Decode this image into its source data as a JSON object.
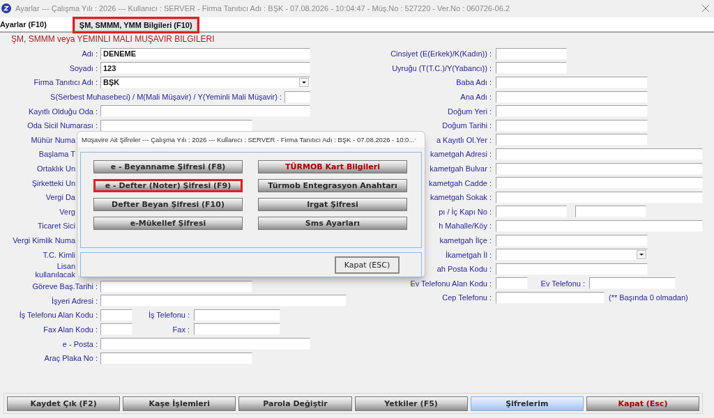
{
  "window": {
    "title": "Ayarlar --- Çalışma Yılı : 2026 --- Kullanıcı : SERVER - Firma Tanıtıcı Adı : BŞK - 07.08.2026 - 10:04:47 - Müş.No : 527220 - Ver.No : 060726-06.2"
  },
  "tabs": [
    {
      "label": "Ayarlar (F10)",
      "selected": false,
      "highlighted": false
    },
    {
      "label": "ŞM, SMMM, YMM Bilgileri (F10)",
      "selected": true,
      "highlighted": true
    }
  ],
  "heading": "ŞM, SMMM veya YEMINLI MALI MUŞAVIR BILGILERI",
  "left_rows": [
    {
      "label": "Adı :",
      "fields": [
        {
          "kind": "long",
          "value": "DENEME"
        }
      ]
    },
    {
      "label": "Soyadı :",
      "fields": [
        {
          "kind": "long",
          "value": "123"
        }
      ]
    },
    {
      "label": "Firma Tanıtıcı Adı :",
      "fields": [
        {
          "kind": "long",
          "value": "BŞK",
          "dropdown": true
        }
      ]
    },
    {
      "label": "S(Serbest Muhasebeci) / M(Mali Müşavir) / Y(Yeminli Mali Müşavir) :",
      "fields": [
        {
          "kind": "tiny"
        }
      ]
    },
    {
      "label": "Kayıtlı Olduğu Oda :",
      "fields": [
        {
          "kind": "long"
        }
      ]
    },
    {
      "label": "Oda Sicil Numarası :",
      "fields": [
        {
          "kind": "medium"
        }
      ]
    },
    {
      "label": "Mühür Numa"
    },
    {
      "label": "Başlama T"
    },
    {
      "label": "Ortaklık Un"
    },
    {
      "label": "Şirketteki Un"
    },
    {
      "label": "Vergi Da"
    },
    {
      "label": "Verg"
    },
    {
      "label": "Ticaret Sici"
    },
    {
      "label": "Vergi Kimlik Numa"
    },
    {
      "label": "T.C. Kimli"
    },
    {
      "label_lines": [
        "Lisan",
        "kullanılacak"
      ]
    },
    {
      "label": "Göreve Baş.Tarihi :",
      "fields": [
        {
          "kind": "medium"
        }
      ]
    },
    {
      "label": "İşyeri Adresi :",
      "fields": [
        {
          "kind": "address"
        }
      ]
    },
    {
      "label": "İş Telefonu Alan Kodu :",
      "fields": [
        {
          "kind": "short"
        },
        {
          "kind": "phone",
          "label": "İş Telefonu :"
        }
      ]
    },
    {
      "label": "Fax Alan Kodu :",
      "fields": [
        {
          "kind": "short"
        },
        {
          "kind": "phone",
          "label": "Fax :"
        }
      ]
    },
    {
      "label": "e - Posta :",
      "fields": [
        {
          "kind": "long"
        }
      ]
    },
    {
      "label": "Araç Plaka No :",
      "fields": [
        {
          "kind": "medium"
        }
      ]
    }
  ],
  "right_rows": [
    {
      "label": "Cinsiyet (E(Erkek)/K(Kadın)) :",
      "fields": [
        {
          "kind": "small"
        }
      ]
    },
    {
      "label": "Uyruğu (T(T.C.)/Y(Yabancı)) :",
      "fields": [
        {
          "kind": "small"
        }
      ]
    },
    {
      "label": "Baba Adı :",
      "fields": [
        {
          "kind": "medium"
        }
      ]
    },
    {
      "label": "Ana Adı :",
      "fields": [
        {
          "kind": "medium"
        }
      ]
    },
    {
      "label": "Doğum Yeri :",
      "fields": [
        {
          "kind": "medium"
        }
      ]
    },
    {
      "label": "Doğum Tarihi :",
      "fields": [
        {
          "kind": "medium"
        }
      ]
    },
    {
      "label": "a Kayıtlı Ol.Yer :",
      "fields": [
        {
          "kind": "medium"
        }
      ]
    },
    {
      "label": "kametgah Adresi :",
      "fields": [
        {
          "kind": "wide"
        }
      ]
    },
    {
      "label": "kametgah Bulvar :",
      "fields": [
        {
          "kind": "wide"
        }
      ]
    },
    {
      "label": "kametgah Cadde :",
      "fields": [
        {
          "kind": "wide"
        }
      ]
    },
    {
      "label": "kametgah Sokak :",
      "fields": [
        {
          "kind": "wide"
        }
      ]
    },
    {
      "label": "pı / İç Kapı No :",
      "fields": [
        {
          "kind": "small"
        },
        {
          "kind": "small"
        }
      ]
    },
    {
      "label": "h Mahalle/Köy :",
      "fields": [
        {
          "kind": "wide"
        }
      ]
    },
    {
      "label": "kametgah İlçe :",
      "fields": [
        {
          "kind": "medium"
        }
      ]
    },
    {
      "label": "İkametgah İl :",
      "fields": [
        {
          "kind": "medium",
          "dropdown": true
        }
      ]
    },
    {
      "label": "ah Posta Kodu :",
      "fields": [
        {
          "kind": "medium"
        }
      ]
    },
    {
      "label": "Ev Telefonu Alan Kodu :",
      "fields": [
        {
          "kind": "short"
        },
        {
          "kind": "phone",
          "label": "Ev Telefonu :"
        }
      ]
    },
    {
      "label": "Cep Telefonu :",
      "fields": [
        {
          "kind": "cell"
        },
        {
          "kind": "note",
          "text": "(** Başında 0 olmadan)"
        }
      ]
    }
  ],
  "dialog": {
    "title": "Müşavire Ait Şifreler --- Çalışma Yılı : 2026 --- Kullanıcı : SERVER - Firma Tanıtıcı Adı : BŞK - 07.08.2026 - 10:0...",
    "buttons": [
      {
        "label": "e - Beyanname Şifresi (F8)",
        "color": "#2a2a2a",
        "highlighted": false
      },
      {
        "label": "TÜRMOB Kart Bilgileri",
        "color": "#a80000",
        "highlighted": false
      },
      {
        "label": "e - Defter (Noter) Şifresi (F9)",
        "color": "#2a2a2a",
        "highlighted": true
      },
      {
        "label": "Türmob Entegrasyon Anahtarı",
        "color": "#2a2a2a",
        "highlighted": false
      },
      {
        "label": "Defter Beyan Şifresi (F10)",
        "color": "#2a2a2a",
        "highlighted": false
      },
      {
        "label": "Irgat Şifresi",
        "color": "#2a2a2a",
        "highlighted": false
      },
      {
        "label": "e-Mükellef Şifresi",
        "color": "#2a2a2a",
        "highlighted": false
      },
      {
        "label": "Sms Ayarları",
        "color": "#2a2a2a",
        "highlighted": false
      }
    ],
    "close_button": "Kapat (ESC)"
  },
  "bottom_buttons": [
    {
      "label": "Kaydet Çık (F2)",
      "color": "#2a2a2a",
      "selected": false
    },
    {
      "label": "Kaşe İşlemleri",
      "color": "#2a2a2a",
      "selected": false
    },
    {
      "label": "Parola Değiştir",
      "color": "#2a2a2a",
      "selected": false
    },
    {
      "label": "Yetkiler (F5)",
      "color": "#2a2a2a",
      "selected": false
    },
    {
      "label": "Şifrelerim",
      "color": "#2a2a2a",
      "selected": true
    },
    {
      "label": "Kapat (Esc)",
      "color": "#a80000",
      "selected": false
    }
  ]
}
